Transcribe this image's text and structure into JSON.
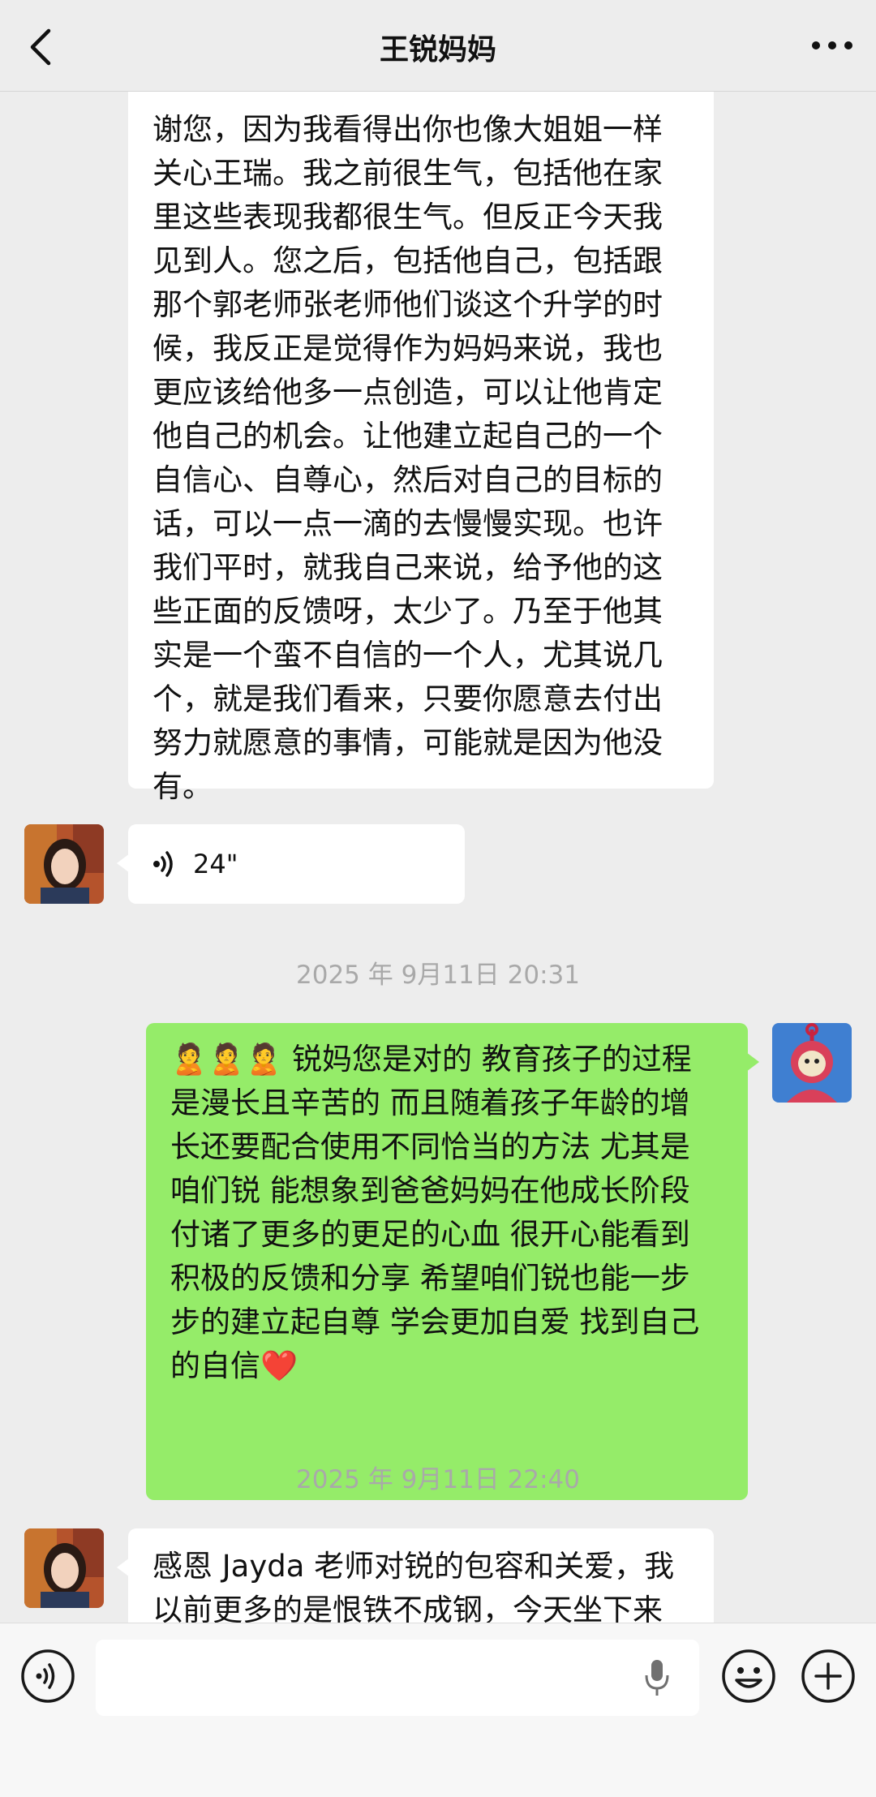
{
  "header": {
    "title": "王锐妈妈"
  },
  "messages": {
    "first": {
      "lines": [
        "谢您，因为我看得出你也像大姐姐一样",
        "关心王瑞。我之前很生气，包括他在家",
        "里这些表现我都很生气。但反正今天我",
        "见到人。您之后，包括他自己，包括跟",
        "那个郭老师张老师他们谈这个升学的时",
        "候，我反正是觉得作为妈妈来说，我也",
        "更应该给他多一点创造，可以让他肯定",
        "他自己的机会。让他建立起自己的一个",
        "自信心、自尊心，然后对自己的目标的",
        "话，可以一点一滴的去慢慢实现。也许",
        "我们平时，就我自己来说，给予他的这",
        "些正面的反馈呀，太少了。乃至于他其",
        "实是一个蛮不自信的一个人，尤其说几",
        "个，就是我们看来，只要你愿意去付出",
        "努力就愿意的事情，可能就是因为他没",
        "有。"
      ]
    },
    "voice": {
      "duration": "24\""
    },
    "timestamp1": "2025 年 9月11日 20:31",
    "reply": {
      "lines": [
        "🙎🙎🙎 锐妈您是对的 教育孩子的过程",
        "是漫长且辛苦的 而且随着孩子年龄的增",
        "长还要配合使用不同恰当的方法 尤其是",
        "咱们锐 能想象到爸爸妈妈在他成长阶段",
        "付诸了更多的更足的心血 很开心能看到",
        "积极的反馈和分享 希望咱们锐也能一步",
        "步的建立起自尊 学会更加自爱 找到自己",
        "的自信❤️"
      ]
    },
    "timestamp2": "2025 年 9月11日 22:40",
    "last": {
      "lines": [
        "感恩 Jayda 老师对锐的包容和关爱，我",
        "以前更多的是恨铁不成钢，今天坐下来"
      ]
    }
  },
  "colors": {
    "green_bubble": "#95ec69",
    "background": "#ededed"
  },
  "icons": [
    "back-arrow-icon",
    "more-icon",
    "voice-wave-icon",
    "voice-input-icon",
    "microphone-icon",
    "emoji-icon",
    "plus-icon"
  ]
}
